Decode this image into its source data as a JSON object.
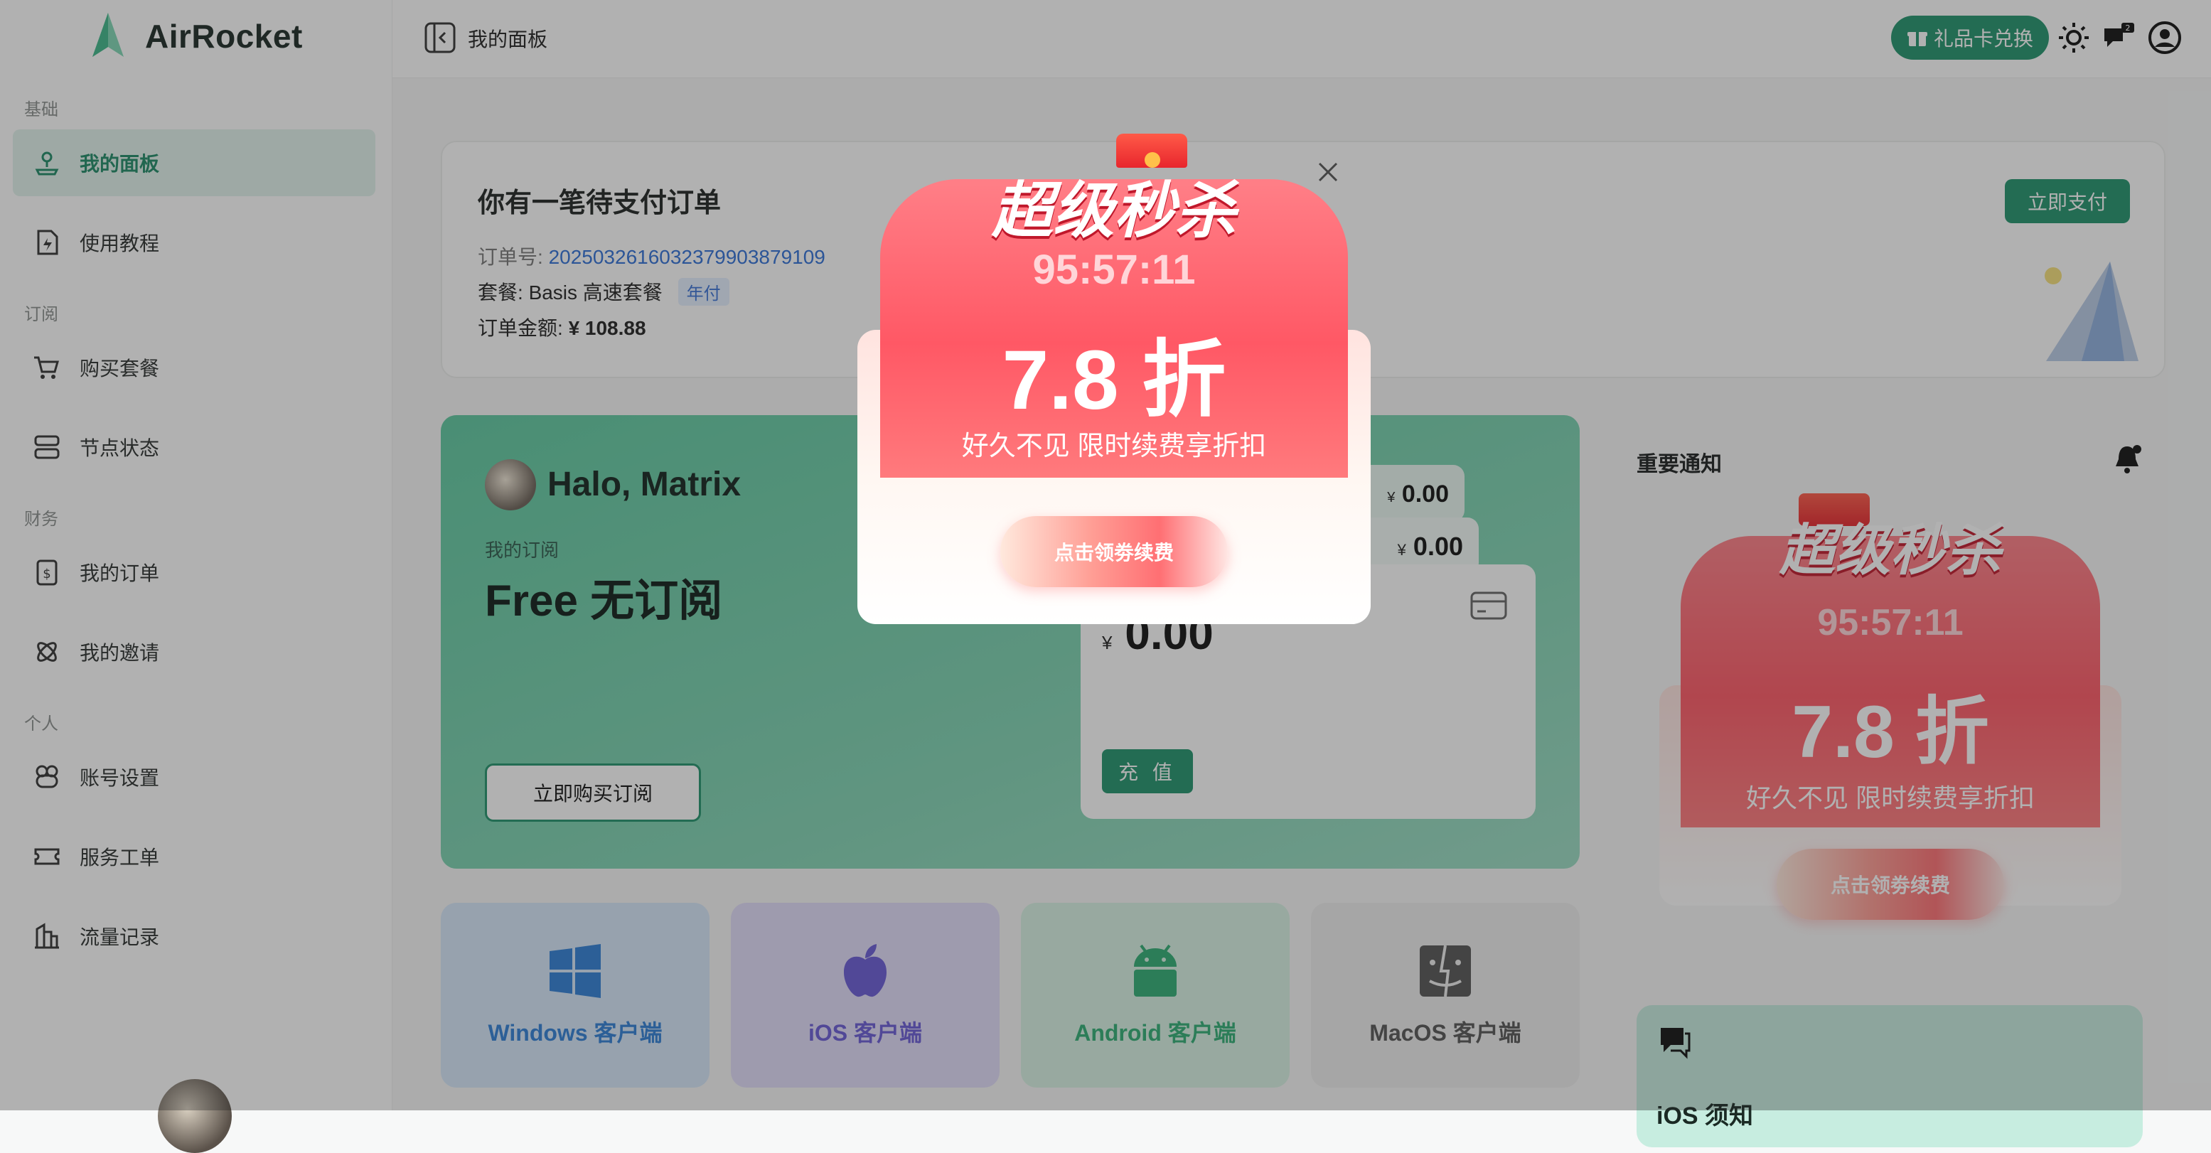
{
  "brand": {
    "name": "AirRocket"
  },
  "sidebar": {
    "sections": [
      {
        "label": "基础",
        "items": [
          {
            "label": "我的面板",
            "active": true,
            "icon": "dashboard-icon"
          },
          {
            "label": "使用教程",
            "icon": "tutorial-icon"
          }
        ]
      },
      {
        "label": "订阅",
        "items": [
          {
            "label": "购买套餐",
            "icon": "cart-icon"
          },
          {
            "label": "节点状态",
            "icon": "server-icon"
          }
        ]
      },
      {
        "label": "财务",
        "items": [
          {
            "label": "我的订单",
            "icon": "order-icon"
          },
          {
            "label": "我的邀请",
            "icon": "invite-icon"
          }
        ]
      },
      {
        "label": "个人",
        "items": [
          {
            "label": "账号设置",
            "icon": "account-icon"
          },
          {
            "label": "服务工单",
            "icon": "ticket-icon"
          },
          {
            "label": "流量记录",
            "icon": "traffic-icon"
          }
        ]
      }
    ]
  },
  "header": {
    "title": "我的面板",
    "gift_label": "礼品卡兑换",
    "notification_count": "2"
  },
  "order": {
    "title": "你有一笔待支付订单",
    "number_label": "订单号:",
    "number": "2025032616032379903879109",
    "plan_label": "套餐:",
    "plan": "Basis 高速套餐",
    "plan_tag": "年付",
    "amount_label": "订单金额:",
    "amount": "¥ 108.88",
    "pay_label": "立即支付"
  },
  "subscription": {
    "greeting": "Halo, Matrix",
    "label": "我的订阅",
    "plan": "Free 无订阅",
    "buy_label": "立即购买订阅"
  },
  "wallet": {
    "currency": "¥",
    "balances": [
      "0.00",
      "0.00",
      "0.00"
    ],
    "recharge_label": "充 值"
  },
  "clients": [
    {
      "label": "Windows 客户端",
      "icon": "windows-icon",
      "color": "#2f7fd6",
      "bg": "#d6e8fb"
    },
    {
      "label": "iOS 客户端",
      "icon": "apple-icon",
      "color": "#6a5bd6",
      "bg": "#e2ddfa"
    },
    {
      "label": "Android 客户端",
      "icon": "android-icon",
      "color": "#2fae74",
      "bg": "#d8f3e5"
    },
    {
      "label": "MacOS 客户端",
      "icon": "finder-icon",
      "color": "#555555",
      "bg": "#eeeeee"
    }
  ],
  "notice": {
    "title": "重要通知",
    "tips_title": "iOS 须知"
  },
  "promo": {
    "title": "超级秒杀",
    "countdown": "95:57:11",
    "discount": "7.8 折",
    "subtitle": "好久不见 限时续费享折扣",
    "button": "点击领劵续费"
  },
  "colors": {
    "accent": "#22946c",
    "promo": "#ff5865"
  }
}
